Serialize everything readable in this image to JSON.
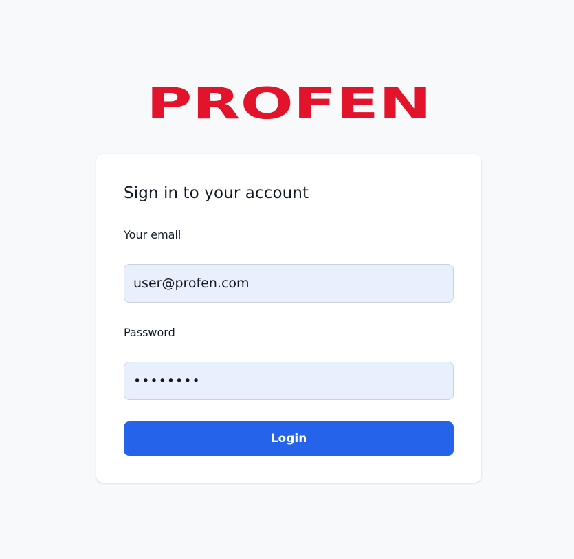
{
  "brand": {
    "logo_text": "PROFEN",
    "logo_color": "#e3132c"
  },
  "login_form": {
    "title": "Sign in to your account",
    "email_label": "Your email",
    "email_value": "user@profen.com",
    "password_label": "Password",
    "password_value": "profen12",
    "login_button_label": "Login"
  },
  "colors": {
    "page_background": "#f8f9fb",
    "input_background": "#e8f0fe",
    "button_background": "#2563eb"
  }
}
